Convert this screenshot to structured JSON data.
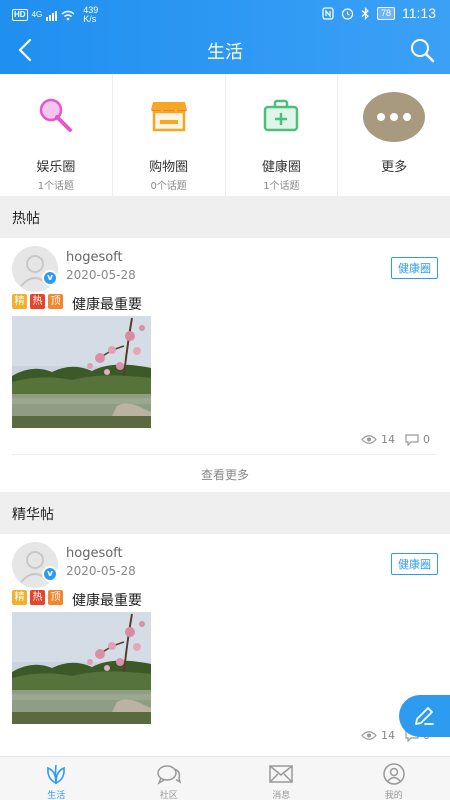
{
  "status_bar": {
    "hd": "HD",
    "network": "4G",
    "speed_value": "439",
    "speed_unit": "K/s",
    "nfc_icon": "nfc-icon",
    "battery": "78",
    "time": "11:13"
  },
  "header": {
    "title": "生活",
    "back_icon": "chevron-left-icon",
    "search_icon": "search-icon"
  },
  "categories": [
    {
      "name": "娱乐圈",
      "count": "1个话题",
      "icon": "microphone-icon",
      "color": "#e855d0"
    },
    {
      "name": "购物圈",
      "count": "0个话题",
      "icon": "shop-icon",
      "color": "#f5a623"
    },
    {
      "name": "健康圈",
      "count": "1个话题",
      "icon": "medkit-icon",
      "color": "#4cbf7a"
    },
    {
      "name": "更多",
      "icon": "more-icon",
      "color": "#a89a7e"
    }
  ],
  "sections": {
    "hot": "热帖",
    "essence": "精华帖"
  },
  "posts": [
    {
      "user": "hogesoft",
      "date": "2020-05-28",
      "circle": "健康圈",
      "flags": [
        "精",
        "热",
        "顶"
      ],
      "title": "健康最重要",
      "views": "14",
      "comments": "0",
      "see_more": "查看更多"
    },
    {
      "user": "hogesoft",
      "date": "2020-05-28",
      "circle": "健康圈",
      "flags": [
        "精",
        "热",
        "顶"
      ],
      "title": "健康最重要",
      "views": "14",
      "comments": "0"
    }
  ],
  "tabs": [
    {
      "label": "生活",
      "icon": "leaf-icon",
      "active": true
    },
    {
      "label": "社区",
      "icon": "chat-bubble-icon",
      "active": false
    },
    {
      "label": "消息",
      "icon": "envelope-icon",
      "active": false
    },
    {
      "label": "我的",
      "icon": "user-circle-icon",
      "active": false
    }
  ],
  "colors": {
    "accent": "#2d9cf0",
    "header": "#1f8ff0"
  }
}
